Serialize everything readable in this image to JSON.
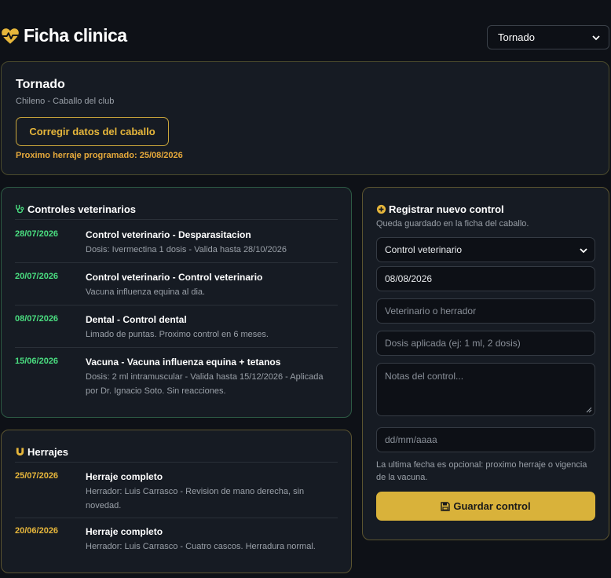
{
  "header": {
    "title": "Ficha clinica",
    "selected_horse": "Tornado"
  },
  "profile": {
    "name": "Tornado",
    "subtitle": "Chileno - Caballo del club",
    "edit_label": "Corregir datos del caballo",
    "next_shoeing": "Proximo herraje programado: 25/08/2026"
  },
  "vet": {
    "title": "Controles veterinarios",
    "entries": [
      {
        "date": "28/07/2026",
        "title": "Control veterinario - Desparasitacion",
        "desc": "Dosis: Ivermectina 1 dosis - Valida hasta 28/10/2026"
      },
      {
        "date": "20/07/2026",
        "title": "Control veterinario - Control veterinario",
        "desc": "Vacuna influenza equina al dia."
      },
      {
        "date": "08/07/2026",
        "title": "Dental - Control dental",
        "desc": "Limado de puntas. Proximo control en 6 meses."
      },
      {
        "date": "15/06/2026",
        "title": "Vacuna - Vacuna influenza equina + tetanos",
        "desc": "Dosis: 2 ml intramuscular - Valida hasta 15/12/2026 - Aplicada por Dr. Ignacio Soto. Sin reacciones."
      }
    ]
  },
  "shoeing": {
    "title": "Herrajes",
    "entries": [
      {
        "date": "25/07/2026",
        "title": "Herraje completo",
        "desc": "Herrador: Luis Carrasco - Revision de mano derecha, sin novedad."
      },
      {
        "date": "20/06/2026",
        "title": "Herraje completo",
        "desc": "Herrador: Luis Carrasco - Cuatro cascos. Herradura normal."
      }
    ]
  },
  "form": {
    "title": "Registrar nuevo control",
    "subtitle": "Queda guardado en la ficha del caballo.",
    "type_value": "Control veterinario",
    "date_value": "08/08/2026",
    "provider_placeholder": "Veterinario o herrador",
    "dose_placeholder": "Dosis aplicada (ej: 1 ml, 2 dosis)",
    "notes_placeholder": "Notas del control...",
    "next_date_placeholder": "dd/mm/aaaa",
    "note": "La ultima fecha es opcional: proximo herraje o vigencia de la vacuna.",
    "save_label": "Guardar control"
  },
  "colors": {
    "accent": "#d9b23a",
    "vet_date": "#4ade80",
    "background": "#0e1117",
    "card": "#161b23"
  },
  "icons": {
    "title": "heart-pulse-icon",
    "vet": "stethoscope-icon",
    "shoe": "horseshoe-icon",
    "form": "plus-circle-icon",
    "save": "floppy-disk-icon"
  }
}
